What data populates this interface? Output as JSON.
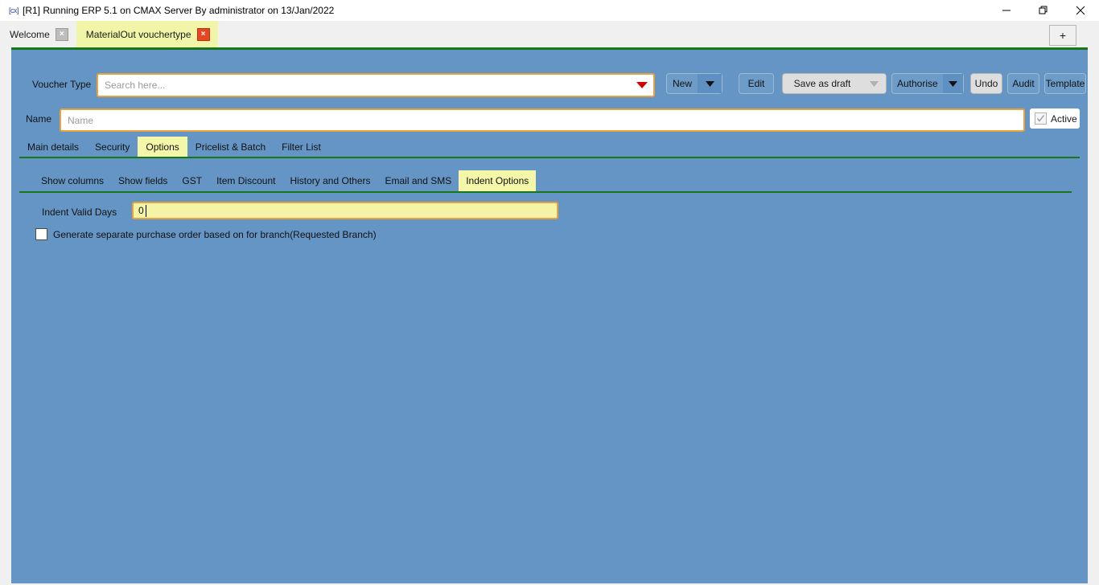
{
  "window": {
    "title": "[R1] Running ERP 5.1 on CMAX Server By administrator on 13/Jan/2022",
    "app_icon": "[cx]",
    "minimize_label": "—",
    "restore_label": "❐",
    "close_label": "✕"
  },
  "tabstrip": {
    "tabs": [
      {
        "label": "Welcome",
        "close": "×",
        "active": false
      },
      {
        "label": "MaterialOut vouchertype",
        "close": "×",
        "active": true
      }
    ],
    "new_tab_label": "+"
  },
  "toolbar": {
    "voucher_type_label": "Voucher Type",
    "search_placeholder": "Search here...",
    "search_value": "",
    "buttons": {
      "new": "New",
      "edit": "Edit",
      "save_as_draft": "Save as draft",
      "authorise": "Authorise",
      "undo": "Undo",
      "audit": "Audit",
      "template": "Template"
    }
  },
  "name_row": {
    "label": "Name",
    "placeholder": "Name",
    "value": "",
    "active_label": "Active",
    "active_checked": true
  },
  "main_tabs": [
    {
      "label": "Main details",
      "active": false
    },
    {
      "label": "Security",
      "active": false
    },
    {
      "label": "Options",
      "active": true
    },
    {
      "label": "Pricelist & Batch",
      "active": false
    },
    {
      "label": "Filter List",
      "active": false
    }
  ],
  "sub_tabs": [
    {
      "label": "Show columns",
      "active": false
    },
    {
      "label": "Show fields",
      "active": false
    },
    {
      "label": "GST",
      "active": false
    },
    {
      "label": "Item Discount",
      "active": false
    },
    {
      "label": "History and Others",
      "active": false
    },
    {
      "label": "Email and SMS",
      "active": false
    },
    {
      "label": "Indent Options",
      "active": true
    }
  ],
  "indent_options": {
    "valid_days_label": "Indent Valid Days",
    "valid_days_value": "0",
    "separate_po_label": "Generate separate purchase order based on for branch(Requested Branch)",
    "separate_po_checked": false
  },
  "colors": {
    "panel_blue": "#6495c4",
    "accent_green": "#17751a",
    "highlight_yellow": "#f4f6a8",
    "field_border_orange": "#e8a33d",
    "close_red": "#e8441f"
  }
}
